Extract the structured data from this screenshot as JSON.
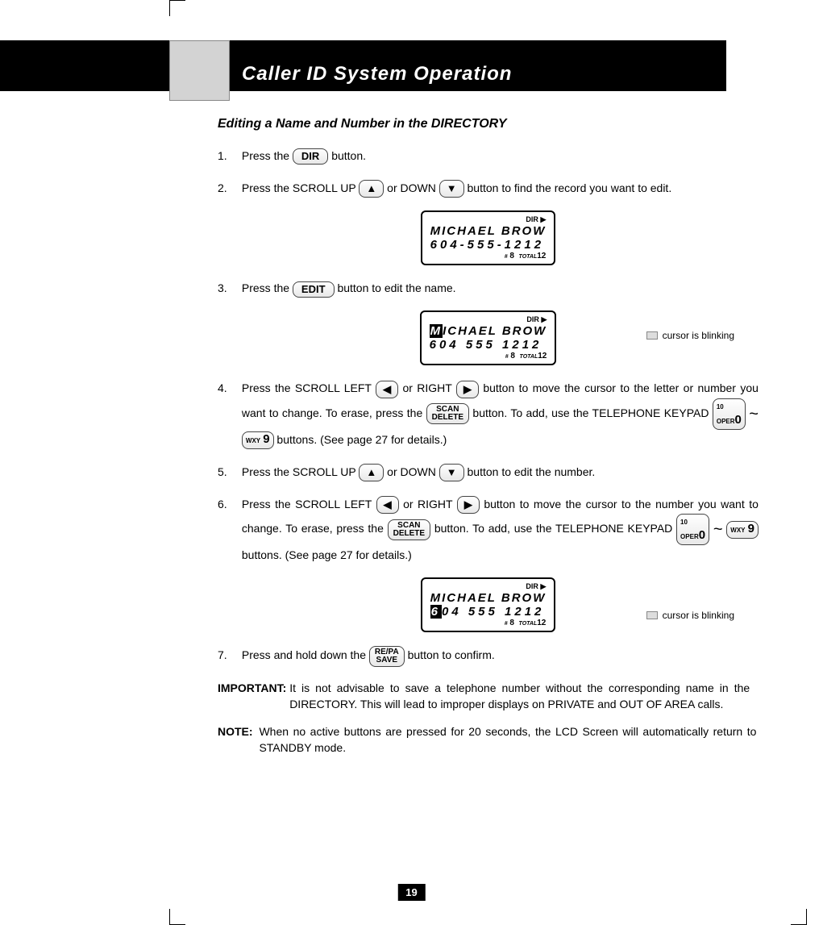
{
  "header": {
    "title": "Caller ID System Operation"
  },
  "subhead": "Editing a Name and Number in the DIRECTORY",
  "buttons": {
    "dir": "DIR",
    "edit": "EDIT",
    "scan_delete_top": "SCAN",
    "scan_delete_bot": "DELETE",
    "repa_save_top": "RE/PA",
    "repa_save_bot": "SAVE",
    "key0_sup": "10",
    "key0_sub": "OPER",
    "key0_main": "0",
    "key9_sub": "WXY",
    "key9_main": "9"
  },
  "arrows": {
    "up": "▲",
    "down": "▼",
    "left": "◀",
    "right": "▶",
    "dir_tri": "▶"
  },
  "steps": {
    "s1_n": "1.",
    "s1_a": "Press the ",
    "s1_b": " button.",
    "s2_n": "2.",
    "s2_a": "Press the SCROLL UP ",
    "s2_b": " or DOWN ",
    "s2_c": " button to find the record you want to edit.",
    "s3_n": "3.",
    "s3_a": "Press the ",
    "s3_b": " button to edit the name.",
    "s4_n": "4.",
    "s4_a": "Press the SCROLL LEFT ",
    "s4_b": " or RIGHT ",
    "s4_c": " button to move the cursor to the letter or number you want to change. To erase, press the ",
    "s4_d": " button. To add, use the TELEPHONE KEYPAD ",
    "s4_e": " buttons. (See page 27 for details.)",
    "s5_n": "5.",
    "s5_a": "Press the SCROLL UP ",
    "s5_b": " or DOWN ",
    "s5_c": " button to edit the number.",
    "s6_n": "6.",
    "s6_a": "Press the SCROLL LEFT ",
    "s6_b": " or RIGHT ",
    "s6_c": " button to move the cursor to the number you want to change. To erase, press the ",
    "s6_d": " button. To add, use the TELEPHONE KEYPAD ",
    "s6_e": " buttons. (See page 27 for details.)",
    "s7_n": "7.",
    "s7_a": "Press and hold down the ",
    "s7_b": " button to confirm."
  },
  "lcd": {
    "dir_label": "DIR",
    "name": "MICHAEL BROW",
    "num1": "604-555-1212",
    "num2": "604 555 1212",
    "hash": "#",
    "idx": "8",
    "total_label": "TOTAL",
    "total": "12",
    "cursor_note": "cursor is blinking",
    "inv_M": "M",
    "inv_6": "6",
    "rest_name": "ICHAEL BROW",
    "rest_num": "04 555 1212"
  },
  "important": {
    "label": "IMPORTANT",
    "colon": ":",
    "text": "It is not advisable to save a telephone number without the corresponding name in the DIRECTORY. This will lead to improper displays on PRIVATE and OUT OF AREA calls."
  },
  "note": {
    "label": "NOTE",
    "colon": ":",
    "text": "When no active buttons are pressed for 20 seconds, the LCD Screen will automatically return to STANDBY mode."
  },
  "page": "19",
  "tilde": "~"
}
